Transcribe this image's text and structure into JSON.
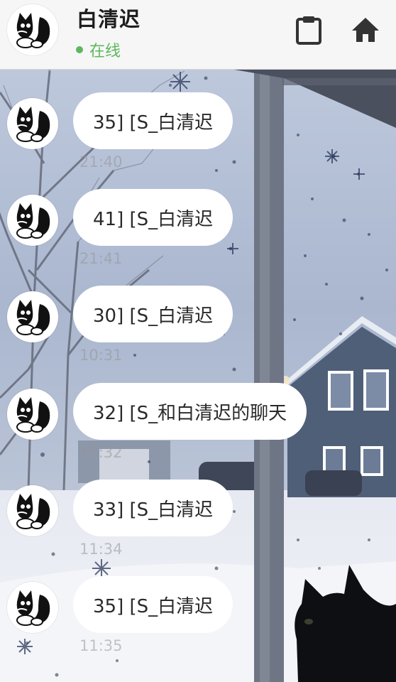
{
  "header": {
    "title": "白清迟",
    "status": "在线",
    "status_color": "#5cb85c",
    "clipboard_icon": "clipboard-icon",
    "home_icon": "home-icon"
  },
  "messages": [
    {
      "text": "35] [S_白清迟",
      "time": "21:40"
    },
    {
      "text": "41] [S_白清迟",
      "time": "21:41"
    },
    {
      "text": "30] [S_白清迟",
      "time": "10:31"
    },
    {
      "text": "32] [S_和白清迟的聊天",
      "time": "11:32"
    },
    {
      "text": "33] [S_白清迟",
      "time": "11:34"
    },
    {
      "text": "35] [S_白清迟",
      "time": "11:35"
    }
  ]
}
